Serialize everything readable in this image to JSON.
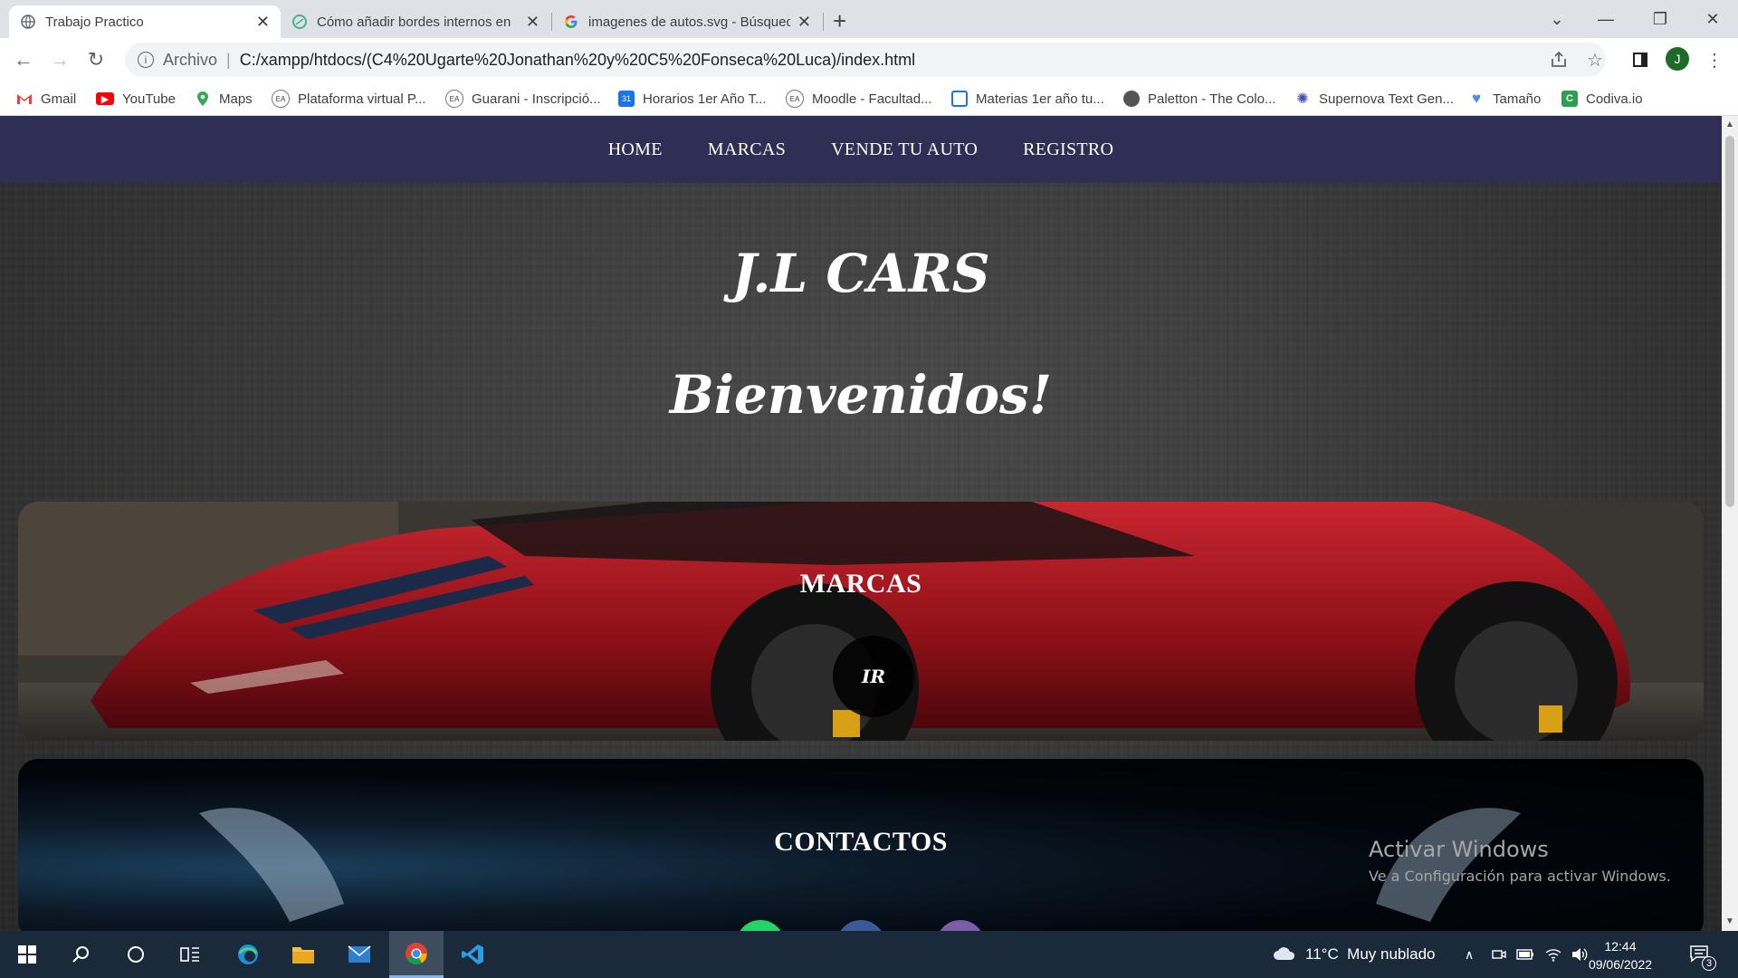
{
  "browser": {
    "tabs": [
      {
        "title": "Trabajo Practico",
        "icon": "globe-icon",
        "active": true
      },
      {
        "title": "Cómo añadir bordes internos en",
        "icon": "circle-icon",
        "active": false
      },
      {
        "title": "imagenes de autos.svg - Búsqued",
        "icon": "google-icon",
        "active": false
      }
    ],
    "url_scheme": "Archivo",
    "url": "C:/xampp/htdocs/(C4%20Ugarte%20Jonathan%20y%20C5%20Fonseca%20Luca)/index.html",
    "profile_initial": "J",
    "bookmarks": [
      {
        "label": "Gmail",
        "icon": "gmail-icon"
      },
      {
        "label": "YouTube",
        "icon": "youtube-icon"
      },
      {
        "label": "Maps",
        "icon": "maps-icon"
      },
      {
        "label": "Plataforma virtual P...",
        "icon": "ea-icon"
      },
      {
        "label": "Guarani - Inscripció...",
        "icon": "ea-icon"
      },
      {
        "label": "Horarios 1er Año T...",
        "icon": "calendar-icon"
      },
      {
        "label": "Moodle - Facultad...",
        "icon": "ea-icon"
      },
      {
        "label": "Materias 1er año tu...",
        "icon": "board-icon"
      },
      {
        "label": "Paletton - The Colo...",
        "icon": "paletton-icon"
      },
      {
        "label": "Supernova Text Gen...",
        "icon": "supernova-icon"
      },
      {
        "label": "Tamaño",
        "icon": "heart-icon"
      },
      {
        "label": "Codiva.io",
        "icon": "codiva-icon"
      }
    ]
  },
  "site": {
    "nav": [
      "HOME",
      "MARCAS",
      "VENDE TU AUTO",
      "REGISTRO"
    ],
    "brand": "J.L CARS",
    "welcome": "Bienvenidos!",
    "marcas_title": "MARCAS",
    "marcas_button": "IR",
    "contactos_title": "CONTACTOS"
  },
  "windows_watermark": {
    "line1": "Activar Windows",
    "line2": "Ve a Configuración para activar Windows."
  },
  "taskbar": {
    "weather": "11°C  Muy nublado",
    "time": "12:44",
    "date": "09/06/2022",
    "notifications": "3"
  },
  "colors": {
    "site_nav": "#2f2f55",
    "car_red": "#a5121b",
    "whatsapp": "#25d366",
    "facebook": "#3b5998",
    "instagram": "#7b5ea7"
  }
}
